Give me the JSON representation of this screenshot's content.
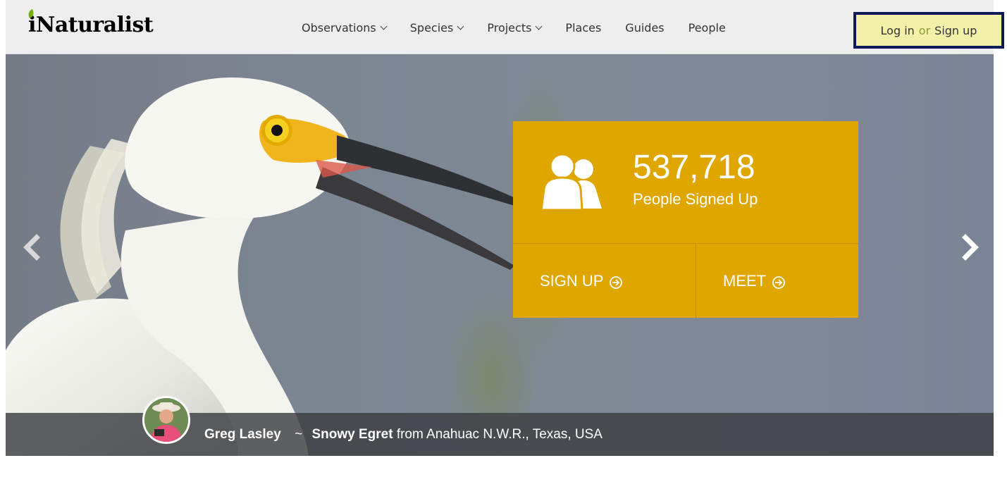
{
  "header": {
    "logo_text": "iNaturalist",
    "nav": [
      {
        "label": "Observations",
        "has_dropdown": true
      },
      {
        "label": "Species",
        "has_dropdown": true
      },
      {
        "label": "Projects",
        "has_dropdown": true
      },
      {
        "label": "Places",
        "has_dropdown": false
      },
      {
        "label": "Guides",
        "has_dropdown": false
      },
      {
        "label": "People",
        "has_dropdown": false
      }
    ],
    "login": {
      "login_label": "Log in",
      "or_label": "or",
      "signup_label": "Sign up"
    }
  },
  "hero": {
    "stats": {
      "count": "537,718",
      "label": "People Signed Up",
      "signup_button": "SIGN UP",
      "meet_button": "MEET",
      "icon": "people-icon"
    },
    "caption": {
      "author": "Greg Lasley",
      "separator": "~",
      "species": "Snowy Egret",
      "location_text": "from Anahuac N.W.R., Texas, USA"
    },
    "prev_icon": "chevron-left-icon",
    "next_icon": "chevron-right-icon"
  },
  "colors": {
    "header_bg": "#eeeeee",
    "card_bg": "#e0a600",
    "login_highlight": "#f3f1a9",
    "login_border": "#0f1c57",
    "logo_leaf": "#74ac00"
  }
}
